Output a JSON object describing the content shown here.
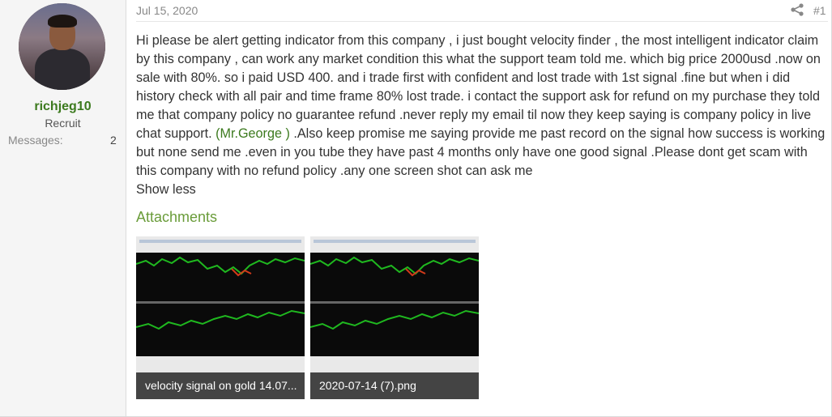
{
  "user": {
    "name": "richjeg10",
    "title": "Recruit",
    "messages_label": "Messages:",
    "messages_count": "2"
  },
  "post": {
    "date": "Jul 15, 2020",
    "number": "#1",
    "body_before": "Hi please be alert getting indicator from this company , i just bought velocity finder , the most intelligent indicator claim by this company , can work any market condition this what the support team told me. which big price 2000usd .now on sale with 80%. so i paid USD 400. and i trade first with confident and lost trade with 1st signal .fine but when i did history check with all pair and time frame 80% lost trade. i contact the support ask for refund on my purchase they told me that company policy no guarantee refund .never reply my email til now they keep saying is company policy in live chat support. ",
    "mention": "(Mr.George )",
    "body_after": " .Also keep promise me saying provide me past record on the signal how success is working but none send me .even in you tube they have past 4 months only have one good signal .Please dont get scam with this company with no refund policy .any one screen shot can ask me",
    "show_less": "Show less"
  },
  "attachments": {
    "title": "Attachments",
    "items": [
      {
        "caption": "velocity signal on gold 14.07..."
      },
      {
        "caption": "2020-07-14 (7).png"
      }
    ]
  },
  "icons": {
    "share": "share-icon"
  },
  "colors": {
    "accent": "#3c7a1e",
    "attach_title": "#6a9c3a",
    "chart_line": "#1fb81f"
  }
}
